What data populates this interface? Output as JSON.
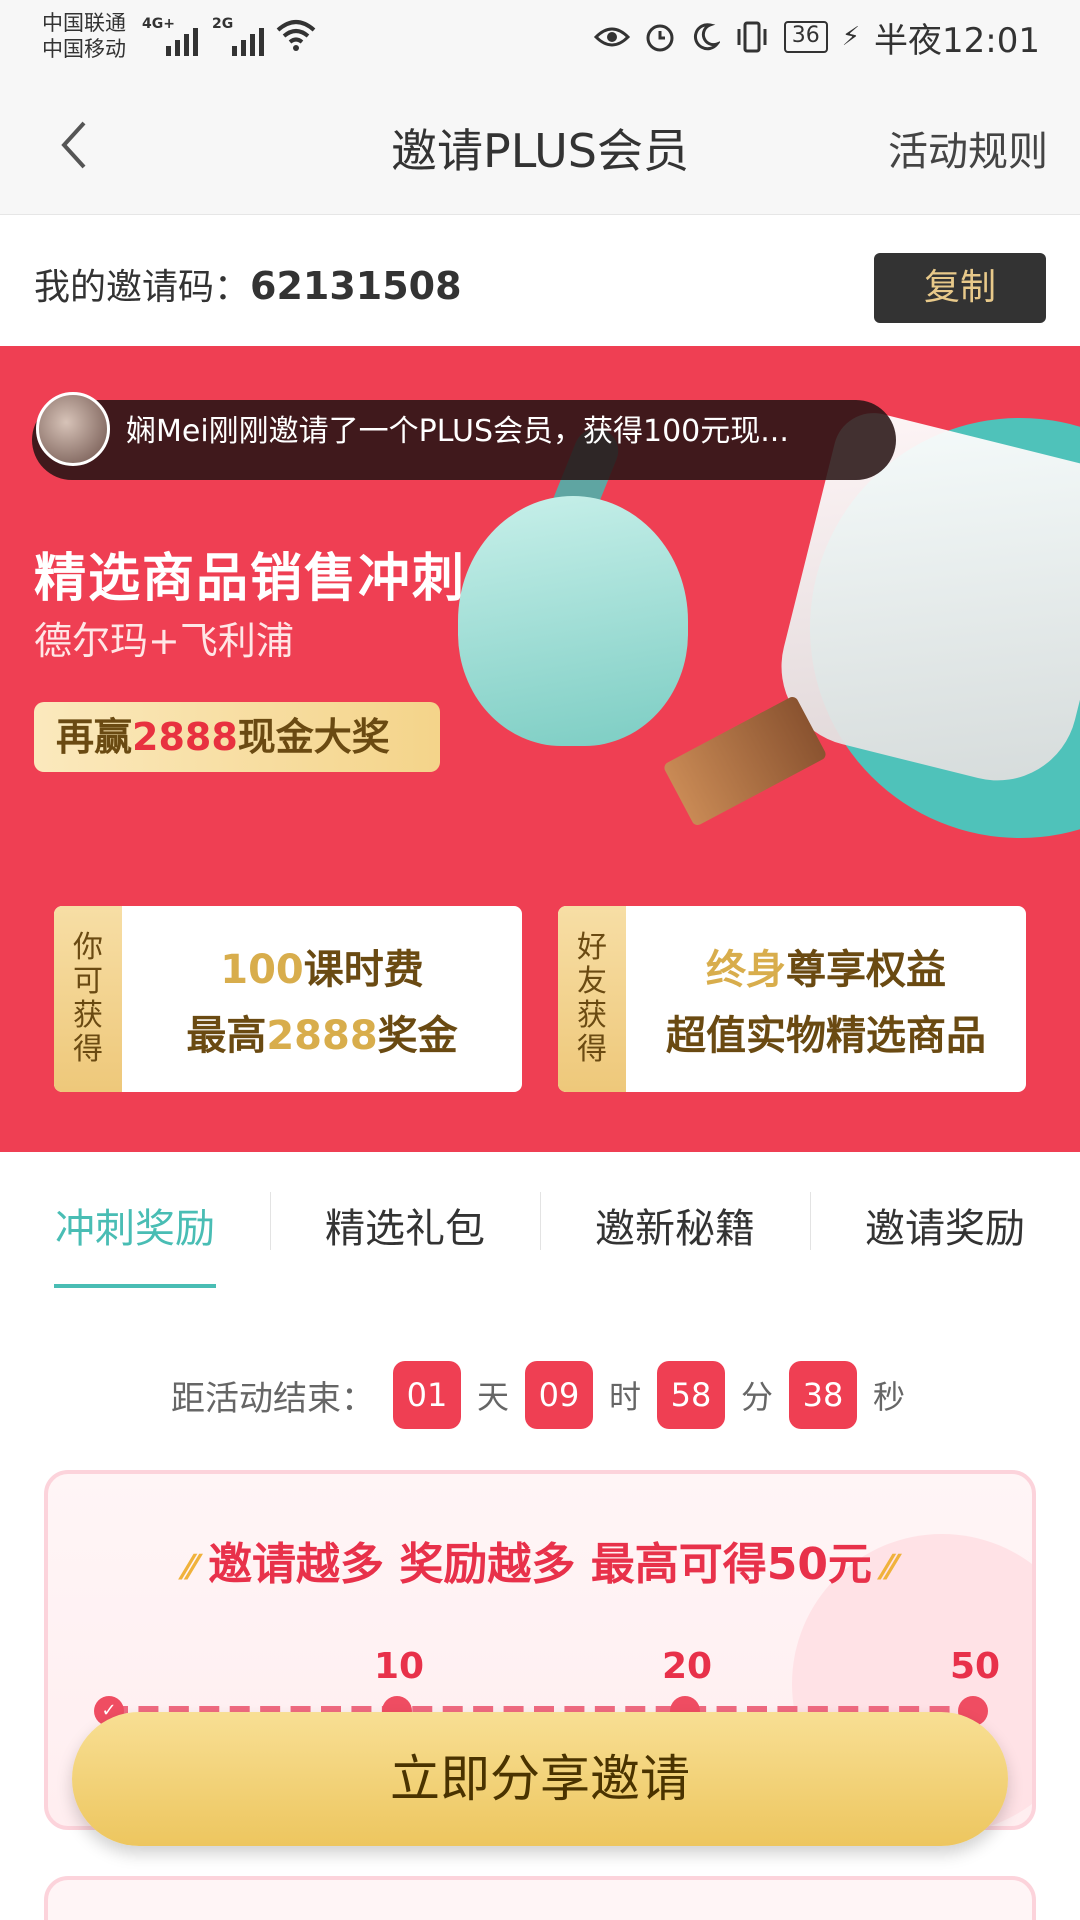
{
  "status_bar": {
    "carrier1": "中国联通",
    "carrier2": "中国移动",
    "net1": "4G+",
    "net2": "2G",
    "battery": "36",
    "time": "半夜12:01"
  },
  "nav": {
    "title": "邀请PLUS会员",
    "rules_label": "活动规则"
  },
  "invite": {
    "label": "我的邀请码：",
    "code": "62131508",
    "copy_label": "复制"
  },
  "banner": {
    "ticker": "娴Mei刚刚邀请了一个PLUS会员，获得100元现...",
    "title": "精选商品销售冲刺",
    "subtitle": "德尔玛+飞利浦",
    "pill_prefix": "再赢",
    "pill_number": "2888",
    "pill_suffix": "现金大奖",
    "card_left": {
      "side": [
        "你",
        "可",
        "获",
        "得"
      ],
      "line1_num": "100",
      "line1_text": "课时费",
      "line2_prefix": "最高",
      "line2_num": "2888",
      "line2_suffix": "奖金"
    },
    "card_right": {
      "side": [
        "好",
        "友",
        "获",
        "得"
      ],
      "line1_gold": "终身",
      "line1_text": "尊享权益",
      "line2": "超值实物精选商品"
    }
  },
  "tabs": [
    "冲刺奖励",
    "精选礼包",
    "邀新秘籍",
    "邀请奖励"
  ],
  "countdown": {
    "label": "距活动结束：",
    "days": "01",
    "days_unit": "天",
    "hours": "09",
    "hours_unit": "时",
    "minutes": "58",
    "minutes_unit": "分",
    "seconds": "38",
    "seconds_unit": "秒"
  },
  "reward_panel": {
    "title": "邀请越多 奖励越多 最高可得50元",
    "milestones": [
      "10",
      "20",
      "50"
    ],
    "progress": 0
  },
  "share_button": "立即分享邀请",
  "colors": {
    "accent_red": "#ef3f53",
    "teal": "#49bdb4",
    "gold": "#d8ad4c"
  }
}
